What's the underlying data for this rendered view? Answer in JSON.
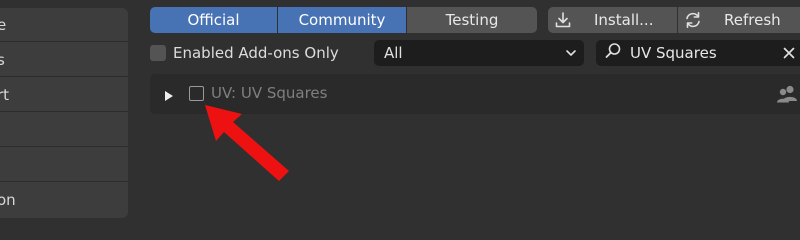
{
  "sidebar": {
    "items": [
      {
        "label": "e"
      },
      {
        "label": "s"
      },
      {
        "label": "rt"
      },
      {
        "label": ""
      },
      {
        "label": ""
      },
      {
        "label": "on"
      }
    ]
  },
  "tabs": [
    {
      "label": "Official",
      "active": true
    },
    {
      "label": "Community",
      "active": true
    },
    {
      "label": "Testing",
      "active": false
    }
  ],
  "toolbar": {
    "install_label": "Install...",
    "refresh_label": "Refresh"
  },
  "filters": {
    "enabled_only_label": "Enabled Add-ons Only",
    "enabled_only_checked": false,
    "category_value": "All",
    "search_value": "UV Squares"
  },
  "addons": [
    {
      "name": "UV: UV Squares",
      "enabled": false,
      "support": "community"
    }
  ],
  "colors": {
    "accent": "#4772b3",
    "background": "#303030",
    "annotation_arrow": "#ee1111"
  }
}
